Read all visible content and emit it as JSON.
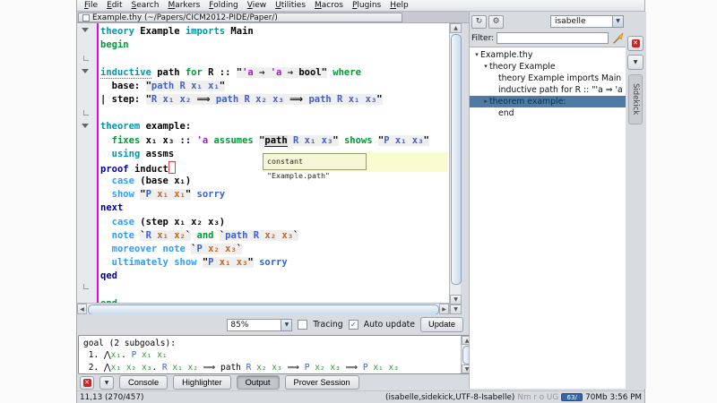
{
  "menu": {
    "items": [
      "File",
      "Edit",
      "Search",
      "Markers",
      "Folding",
      "View",
      "Utilities",
      "Macros",
      "Plugins",
      "Help"
    ]
  },
  "window": {
    "buffer_tab": "Example.thy (~/Papers/CICM2012-PIDE/Paper/)"
  },
  "editor": {
    "tooltip": "constant \"Example.path\"",
    "lines": [
      [
        [
          "k1",
          "theory "
        ],
        [
          "bd",
          "Example "
        ],
        [
          "k1",
          "imports "
        ],
        [
          "bd",
          "Main"
        ]
      ],
      [
        [
          "k2",
          "begin"
        ]
      ],
      [],
      [
        [
          "k1u",
          "inductive"
        ],
        [
          "p",
          " path "
        ],
        [
          "k2",
          "for "
        ],
        [
          "p",
          "R :: "
        ],
        [
          "q",
          "\""
        ],
        [
          "tq",
          "'a"
        ],
        [
          "q",
          " ⇒ "
        ],
        [
          "tq",
          "'a"
        ],
        [
          "q",
          " ⇒ "
        ],
        [
          "bq",
          "bool"
        ],
        [
          "q",
          "\""
        ],
        [
          "p",
          " "
        ],
        [
          "k2",
          "where"
        ]
      ],
      [
        [
          "p",
          "  base: "
        ],
        [
          "q",
          "\""
        ],
        [
          "fq",
          "path R x₁ x₁"
        ],
        [
          "q",
          "\""
        ]
      ],
      [
        [
          "p",
          "| step: "
        ],
        [
          "q",
          "\""
        ],
        [
          "fq",
          "R x₁ x₂"
        ],
        [
          "q",
          " ⟹ "
        ],
        [
          "fq",
          "path R x₂ x₃"
        ],
        [
          "q",
          " ⟹ "
        ],
        [
          "fq",
          "path R x₁ x₃"
        ],
        [
          "q",
          "\""
        ]
      ],
      [],
      [
        [
          "k1",
          "theorem "
        ],
        [
          "p",
          "example:"
        ]
      ],
      [
        [
          "p",
          "  "
        ],
        [
          "k2",
          "fixes "
        ],
        [
          "p",
          "x₁ x₃ :: "
        ],
        [
          "t",
          "'a"
        ],
        [
          "p",
          " "
        ],
        [
          "k2",
          "assumes "
        ],
        [
          "q",
          "\""
        ],
        [
          "hov",
          "path"
        ],
        [
          "q",
          " "
        ],
        [
          "fq",
          "R x₁ x₃"
        ],
        [
          "q",
          "\""
        ],
        [
          "p",
          " "
        ],
        [
          "k2",
          "shows "
        ],
        [
          "q",
          "\""
        ],
        [
          "fq",
          "P x₁ x₃"
        ],
        [
          "q",
          "\""
        ]
      ],
      [
        [
          "p",
          "  "
        ],
        [
          "k1",
          "using "
        ],
        [
          "bd",
          "assms"
        ]
      ],
      [
        [
          "k3",
          "proof "
        ],
        [
          "p",
          "induct"
        ],
        [
          "caret",
          ""
        ]
      ],
      [
        [
          "p",
          "  "
        ],
        [
          "k4",
          "case "
        ],
        [
          "p",
          "(base x₁)"
        ]
      ],
      [
        [
          "p",
          "  "
        ],
        [
          "k4",
          "show "
        ],
        [
          "q",
          "\""
        ],
        [
          "fq",
          "P "
        ],
        [
          "sq",
          "x₁ x₁"
        ],
        [
          "q",
          "\""
        ],
        [
          "p",
          " "
        ],
        [
          "k5",
          "sorry"
        ]
      ],
      [
        [
          "k3",
          "next"
        ]
      ],
      [
        [
          "p",
          "  "
        ],
        [
          "k4",
          "case "
        ],
        [
          "p",
          "(step x₁ x₂ x₃)"
        ]
      ],
      [
        [
          "p",
          "  "
        ],
        [
          "k4",
          "note "
        ],
        [
          "q",
          "`"
        ],
        [
          "fq",
          "R "
        ],
        [
          "sq",
          "x₁ x₂"
        ],
        [
          "q",
          "`"
        ],
        [
          "p",
          " "
        ],
        [
          "k2",
          "and "
        ],
        [
          "q",
          "`"
        ],
        [
          "fq",
          "path R "
        ],
        [
          "sq",
          "x₂ x₃"
        ],
        [
          "q",
          "`"
        ]
      ],
      [
        [
          "p",
          "  "
        ],
        [
          "k4",
          "moreover note "
        ],
        [
          "q",
          "`"
        ],
        [
          "fq",
          "P "
        ],
        [
          "sq",
          "x₂ x₃"
        ],
        [
          "q",
          "`"
        ]
      ],
      [
        [
          "p",
          "  "
        ],
        [
          "k4",
          "ultimately show "
        ],
        [
          "q",
          "\""
        ],
        [
          "fq",
          "P "
        ],
        [
          "sq",
          "x₁ x₃"
        ],
        [
          "q",
          "\""
        ],
        [
          "p",
          " "
        ],
        [
          "k5",
          "sorry"
        ]
      ],
      [
        [
          "k3",
          "qed"
        ]
      ],
      [],
      [
        [
          "k2",
          "end"
        ]
      ]
    ]
  },
  "controls": {
    "zoom_level": "85%",
    "tracing_label": "Tracing",
    "tracing_checked": false,
    "auto_update_label": "Auto update",
    "auto_update_checked": true,
    "update_label": "Update"
  },
  "output_panel": {
    "lines": [
      [
        [
          "p",
          "goal (2 subgoals):"
        ]
      ],
      [
        [
          "p",
          " 1. ⋀"
        ],
        [
          "b",
          "x₁"
        ],
        [
          "p",
          ". "
        ],
        [
          "f",
          "P "
        ],
        [
          "b",
          "x₁ x₁"
        ]
      ],
      [
        [
          "p",
          " 2. ⋀"
        ],
        [
          "b",
          "x₁ x₂ x₃"
        ],
        [
          "p",
          ". "
        ],
        [
          "f",
          "R "
        ],
        [
          "b",
          "x₁ x₂"
        ],
        [
          "p",
          " ⟹ path "
        ],
        [
          "f",
          "R "
        ],
        [
          "b",
          "x₂ x₃"
        ],
        [
          "p",
          " ⟹ "
        ],
        [
          "f",
          "P "
        ],
        [
          "b",
          "x₂ x₃"
        ],
        [
          "p",
          " ⟹ "
        ],
        [
          "f",
          "P "
        ],
        [
          "b",
          "x₁ x₃"
        ]
      ]
    ]
  },
  "dock": {
    "buttons": [
      "Console",
      "Highlighter",
      "Output",
      "Prover Session"
    ],
    "selected_index": 2
  },
  "status": {
    "position": "11,13 (270/457)",
    "mode_info": "(isabelle,sidekick,UTF-8-Isabelle)",
    "flags": "Nm r o UG",
    "memory_used": "63/",
    "memory_total": "70Mb",
    "clock": "3:56 PM"
  },
  "sidekick": {
    "parser_combo": "isabelle",
    "filter_label": "Filter:",
    "tab_label": "Sidekick",
    "tree": [
      {
        "arrow": "▾",
        "label": "Example.thy",
        "indent": 0,
        "selected": false
      },
      {
        "arrow": "▾",
        "label": "theory Example",
        "indent": 1,
        "selected": false
      },
      {
        "arrow": "",
        "label": "theory Example imports Main",
        "indent": 2,
        "selected": false
      },
      {
        "arrow": "",
        "label": "inductive path for R :: \"'a ⇒ 'a ⇒ bool\"",
        "indent": 2,
        "selected": false
      },
      {
        "arrow": "▸",
        "label": "theorem example:",
        "indent": 1,
        "selected": true
      },
      {
        "arrow": "",
        "label": "end",
        "indent": 2,
        "selected": false
      }
    ]
  },
  "colors": {
    "keyword_command": "#0096a8",
    "keyword_minor": "#009933",
    "keyword_proof": "#000099",
    "keyword_proof2": "#2e9cff",
    "free_variable": "#4060d0",
    "skolem_variable": "#c06820",
    "type_variable": "#a020c0",
    "bound_variable": "#339933",
    "gutter_border": "#e800e8",
    "tooltip_bg": "#f7f7d8",
    "selection_bg": "#4d7ba3",
    "memory_bar": "#3465a4"
  }
}
